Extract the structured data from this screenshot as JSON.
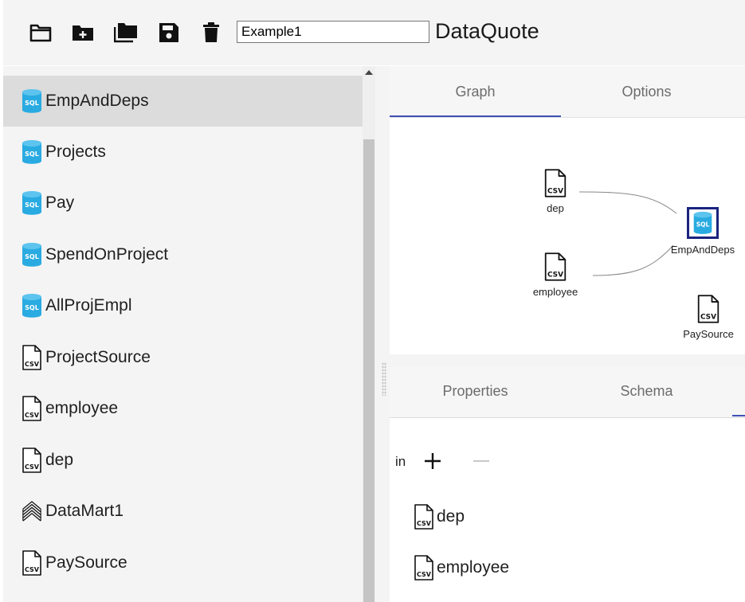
{
  "toolbar": {
    "icons": [
      "folder-open-icon",
      "folder-add-icon",
      "folders-icon",
      "save-icon",
      "trash-icon"
    ],
    "project_name": "Example1",
    "app_title": "DataQuote"
  },
  "sidebar": {
    "items": [
      {
        "label": "EmpAndDeps",
        "icon": "sql-db-icon",
        "selected": true
      },
      {
        "label": "Projects",
        "icon": "sql-db-icon"
      },
      {
        "label": "Pay",
        "icon": "sql-db-icon"
      },
      {
        "label": "SpendOnProject",
        "icon": "sql-db-icon"
      },
      {
        "label": "AllProjEmpl",
        "icon": "sql-db-icon"
      },
      {
        "label": "ProjectSource",
        "icon": "csv-file-icon"
      },
      {
        "label": "employee",
        "icon": "csv-file-icon"
      },
      {
        "label": "dep",
        "icon": "csv-file-icon"
      },
      {
        "label": "DataMart1",
        "icon": "datamart-layers-icon"
      },
      {
        "label": "PaySource",
        "icon": "csv-file-icon"
      }
    ]
  },
  "graph_panel": {
    "tabs": [
      "Graph",
      "Options"
    ],
    "active_tab": "Graph",
    "nodes": [
      {
        "label": "dep",
        "icon": "csv-file-icon"
      },
      {
        "label": "employee",
        "icon": "csv-file-icon"
      },
      {
        "label": "EmpAndDeps",
        "icon": "sql-db-icon",
        "selected": true
      },
      {
        "label": "PaySource",
        "icon": "csv-file-icon"
      }
    ]
  },
  "details_panel": {
    "tabs": [
      "Properties",
      "Schema"
    ],
    "active_tab": "Schema",
    "in_label": "in",
    "inputs": [
      "dep",
      "employee"
    ]
  },
  "colors": {
    "accent": "#3f51b5",
    "sql_icon": "#29abe2",
    "selected_row": "#dcdcdc",
    "node_highlight": "#1a237e"
  }
}
